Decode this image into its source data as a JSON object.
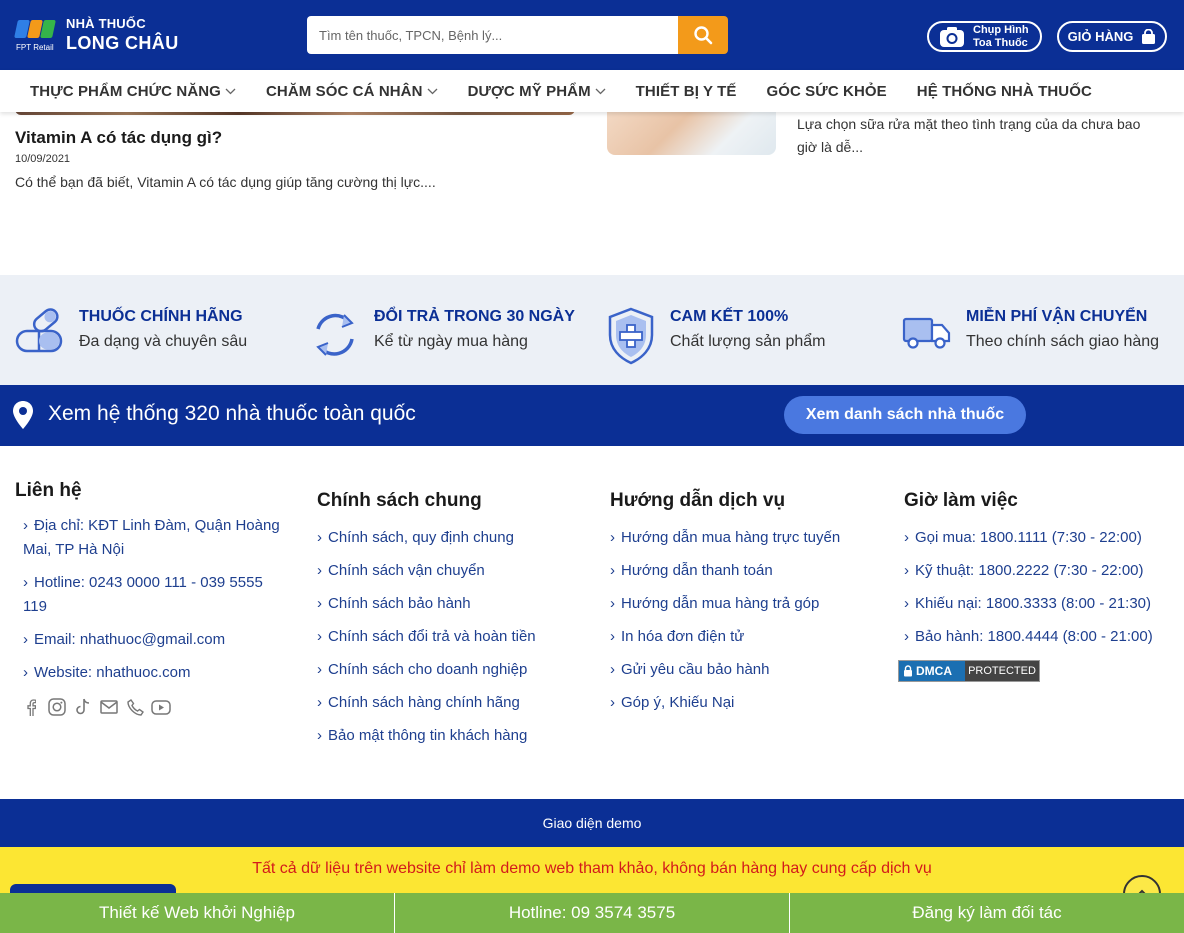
{
  "header": {
    "logo_top": "NHÀ THUỐC",
    "logo_bottom": "LONG CHÂU",
    "logo_sub": "FPT Retail",
    "search_placeholder": "Tìm tên thuốc, TPCN, Bệnh lý...",
    "photo_line1": "Chụp Hình",
    "photo_line2": "Toa Thuốc",
    "cart_label": "GIỎ HÀNG"
  },
  "nav": {
    "items": [
      {
        "label": "THỰC PHẨM CHỨC NĂNG",
        "has_dropdown": true
      },
      {
        "label": "CHĂM SÓC CÁ NHÂN",
        "has_dropdown": true
      },
      {
        "label": "DƯỢC MỸ PHẨM",
        "has_dropdown": true
      },
      {
        "label": "THIẾT BỊ Y TẾ",
        "has_dropdown": false
      },
      {
        "label": "GÓC SỨC KHỎE",
        "has_dropdown": false
      },
      {
        "label": "HỆ THỐNG NHÀ THUỐC",
        "has_dropdown": false
      }
    ]
  },
  "articles": {
    "left": {
      "title": "Vitamin A có tác dụng gì?",
      "date": "10/09/2021",
      "excerpt": "Có thể bạn đã biết, Vitamin A có tác dụng giúp tăng cường thị lực...."
    },
    "right": {
      "excerpt": "Lựa chọn sữa rửa mặt theo tình trạng của da chưa bao giờ là dễ..."
    }
  },
  "commitments": [
    {
      "icon": "pill-capsule-icon",
      "title": "THUỐC CHÍNH HÃNG",
      "subtitle": "Đa dạng và chuyên sâu"
    },
    {
      "icon": "refresh-arrows-icon",
      "title": "ĐỔI TRẢ TRONG 30 NGÀY",
      "subtitle": "Kể từ ngày mua hàng"
    },
    {
      "icon": "shield-cross-icon",
      "title": "CAM KẾT 100%",
      "subtitle": "Chất lượng sản phẩm"
    },
    {
      "icon": "delivery-truck-icon",
      "title": "MIỄN PHÍ VẬN CHUYỂN",
      "subtitle": "Theo chính sách giao hàng"
    }
  ],
  "store_banner": {
    "text": "Xem hệ thống 320 nhà thuốc toàn quốc",
    "button": "Xem danh sách nhà thuốc"
  },
  "footer": {
    "contact": {
      "heading": "Liên hệ",
      "address_line1": "Địa chỉ: KĐT Linh Đàm, Quận Hoàng",
      "address_line2": "Mai, TP Hà Nội",
      "hotline_line1": "Hotline: 0243 0000 111 - 039 5555",
      "hotline_line2": "119",
      "email": "Email: nhathuoc@gmail.com",
      "website": "Website: nhathuoc.com"
    },
    "policy": {
      "heading": "Chính sách chung",
      "links": [
        "Chính sách, quy định chung",
        "Chính sách vận chuyển",
        "Chính sách bảo hành",
        "Chính sách đổi trả và hoàn tiền",
        "Chính sách cho doanh nghiệp",
        "Chính sách hàng chính hãng",
        "Bảo mật thông tin khách hàng"
      ]
    },
    "guide": {
      "heading": "Hướng dẫn dịch vụ",
      "links": [
        "Hướng dẫn mua hàng trực tuyến",
        "Hướng dẫn thanh toán",
        "Hướng dẫn mua hàng trả góp",
        "In hóa đơn điện tử",
        "Gửi yêu cầu bảo hành",
        "Góp ý, Khiếu Nại"
      ]
    },
    "hours": {
      "heading": "Giờ làm việc",
      "links": [
        "Gọi mua: 1800.1111 (7:30 - 22:00)",
        "Kỹ thuật: 1800.2222 (7:30 - 22:00)",
        "Khiếu nại: 1800.3333 (8:00 - 21:30)",
        "Bảo hành: 1800.4444 (8:00 - 21:00)"
      ]
    },
    "dmca_left": "DMCA",
    "dmca_right": "PROTECTED",
    "social_icons": [
      "facebook-icon",
      "instagram-icon",
      "tiktok-icon",
      "email-icon",
      "phone-icon",
      "youtube-icon"
    ]
  },
  "demo_bar": "Giao diện demo",
  "notice": "Tất cả dữ liệu trên website chỉ làm demo web tham khảo, không bán hàng hay cung cấp dịch vụ",
  "bottom_bar": [
    "Thiết kế Web khởi Nghiệp",
    "Hotline: 09 3574 3575",
    "Đăng ký làm đối tác"
  ],
  "colors": {
    "brand_blue": "#0b2f95",
    "accent_orange": "#f39a1a",
    "link_blue": "#1e3f8f",
    "notice_yellow": "#fce633",
    "notice_red": "#d31b1b",
    "bottom_green": "#7ab648"
  }
}
